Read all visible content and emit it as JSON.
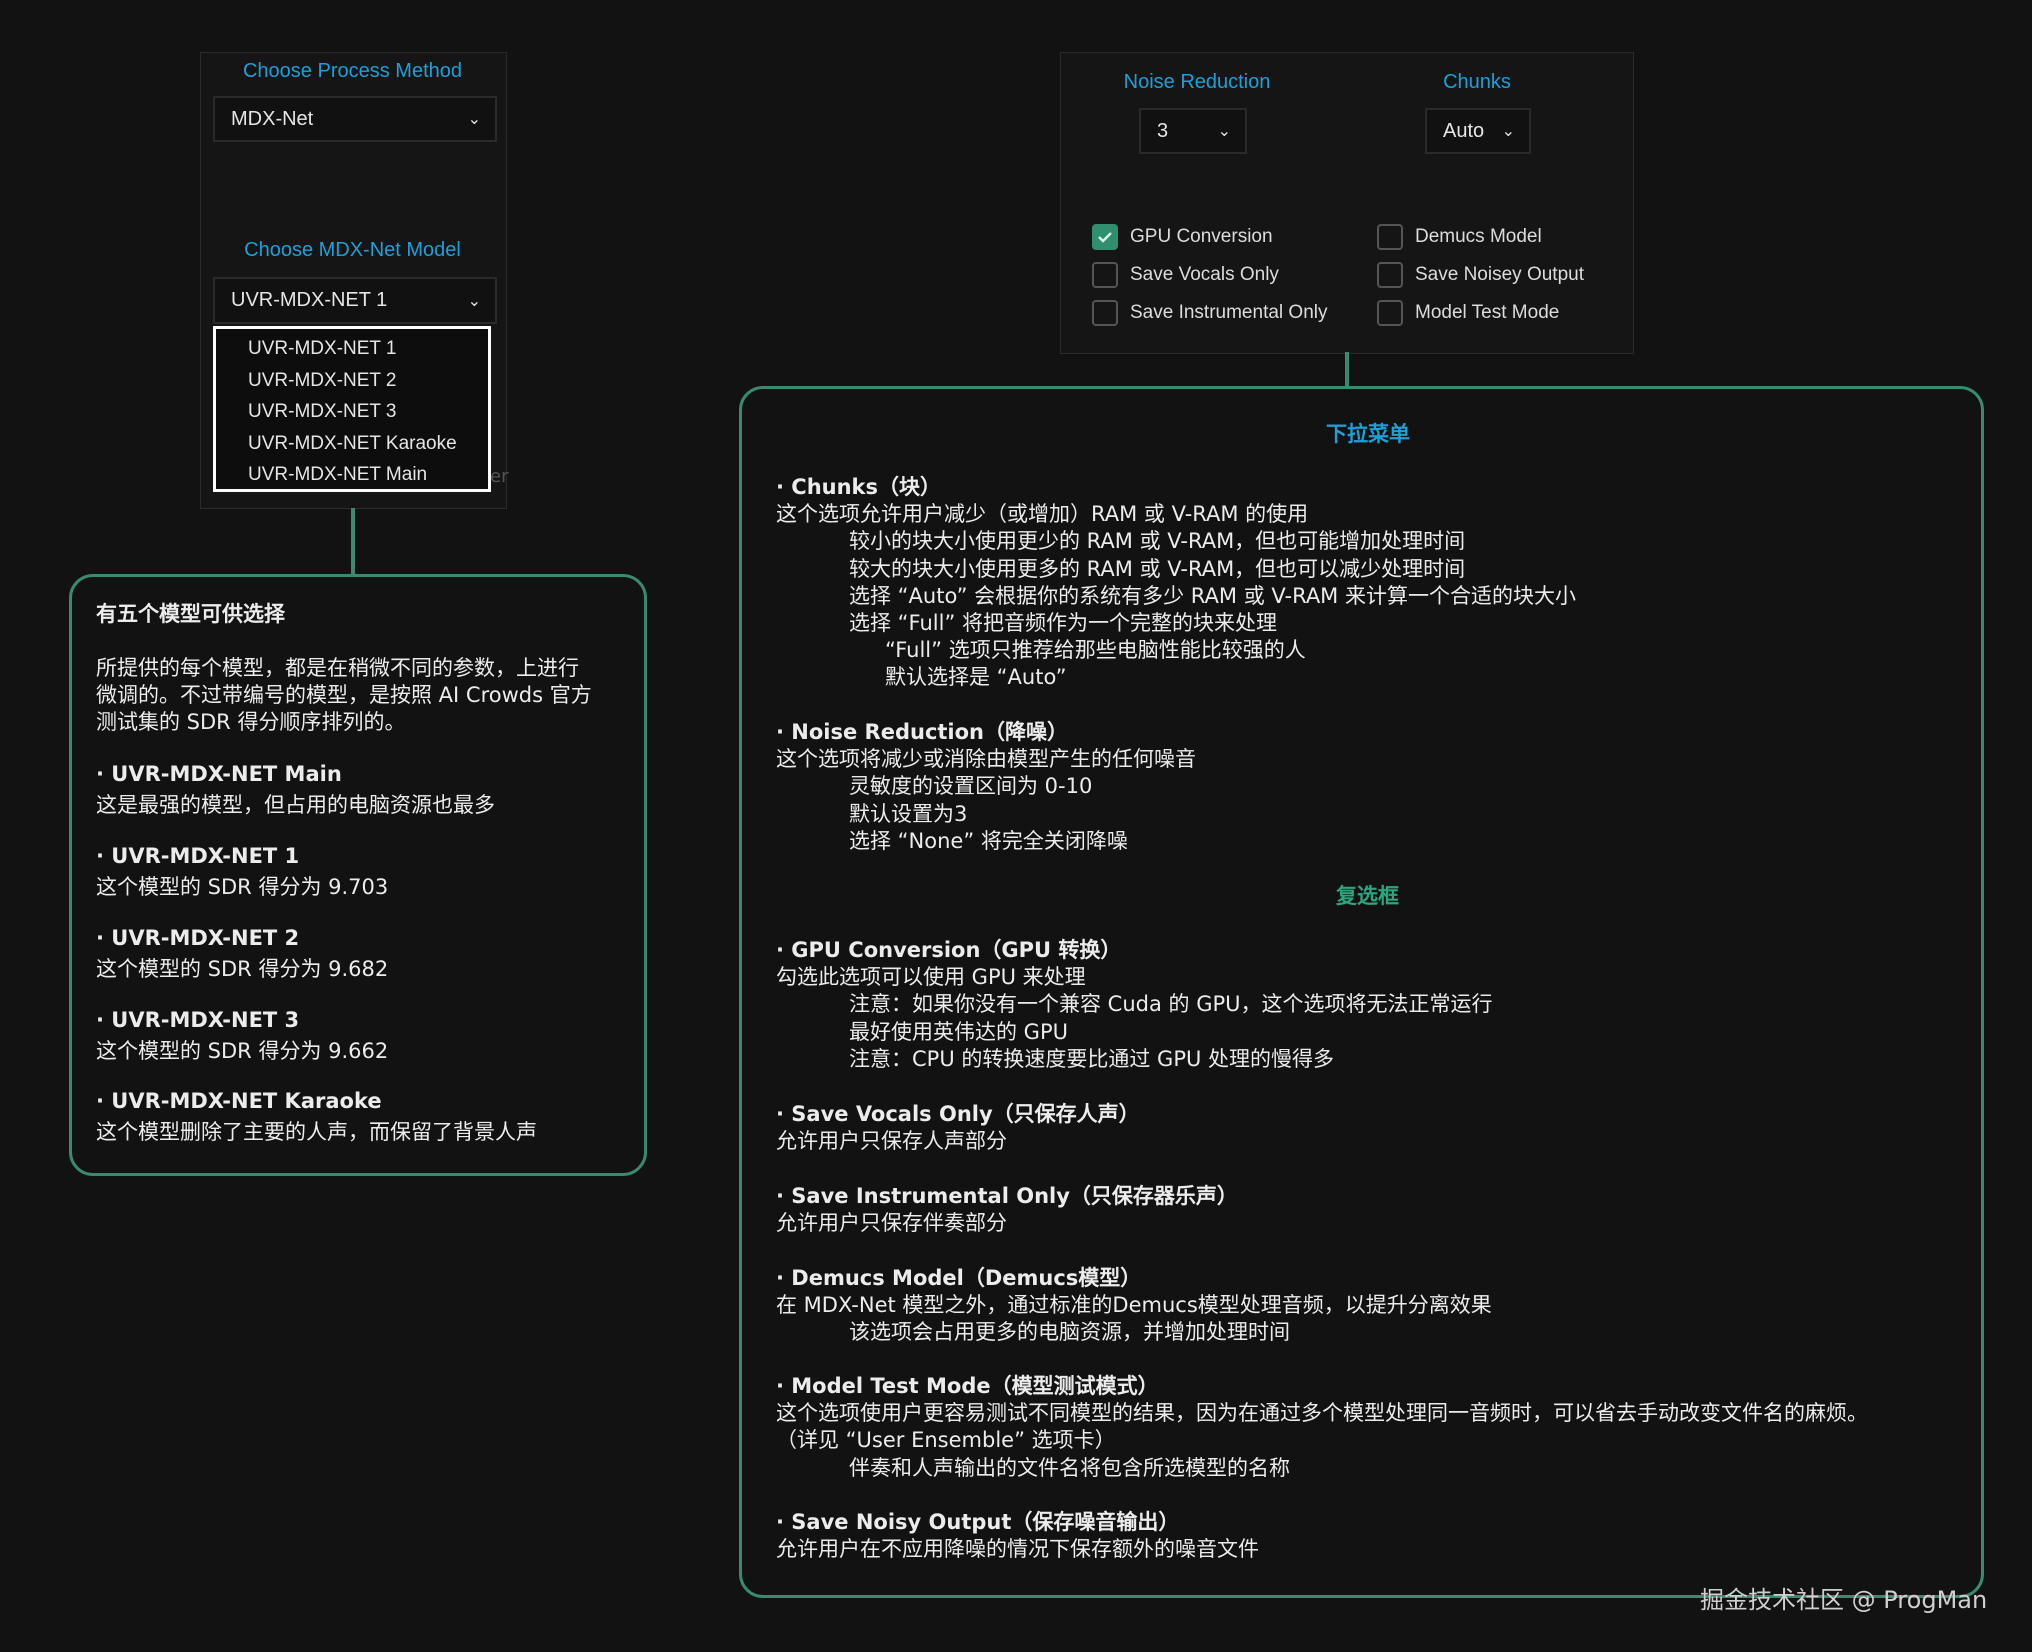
{
  "left_panel": {
    "process_method_label": "Choose Process Method",
    "process_method_value": "MDX-Net",
    "model_label": "Choose MDX-Net Model",
    "model_value": "UVR-MDX-NET 1",
    "model_options": [
      "UVR-MDX-NET 1",
      "UVR-MDX-NET 2",
      "UVR-MDX-NET 3",
      "UVR-MDX-NET Karaoke",
      "UVR-MDX-NET Main"
    ],
    "partial_char": "er"
  },
  "right_panel": {
    "noise_label": "Noise Reduction",
    "noise_value": "3",
    "chunks_label": "Chunks",
    "chunks_value": "Auto",
    "checkboxes": [
      {
        "label": "GPU Conversion",
        "checked": true
      },
      {
        "label": "Save Vocals Only",
        "checked": false
      },
      {
        "label": "Save Instrumental Only",
        "checked": false
      },
      {
        "label": "Demucs Model",
        "checked": false
      },
      {
        "label": "Save Noisey Output",
        "checked": false
      },
      {
        "label": "Model Test Mode",
        "checked": false
      }
    ]
  },
  "left_callout": {
    "title": "有五个模型可供选择",
    "intro": [
      "所提供的每个模型，都是在稍微不同的参数，上进行",
      "微调的。不过带编号的模型，是按照 AI Crowds 官方",
      "测试集的 SDR 得分顺序排列的。"
    ],
    "items": [
      {
        "name": "· UVR-MDX-NET Main",
        "desc": "这是最强的模型，但占用的电脑资源也最多"
      },
      {
        "name": "· UVR-MDX-NET 1",
        "desc": "这个模型的 SDR 得分为 9.703"
      },
      {
        "name": "· UVR-MDX-NET 2",
        "desc": "这个模型的 SDR 得分为 9.682"
      },
      {
        "name": "· UVR-MDX-NET 3",
        "desc": "这个模型的 SDR 得分为 9.662"
      },
      {
        "name": "· UVR-MDX-NET Karaoke",
        "desc": "这个模型删除了主要的人声，而保留了背景人声"
      }
    ]
  },
  "right_callout": {
    "dropdown_title": "下拉菜单",
    "checkbox_title": "复选框",
    "sections": [
      {
        "title": "· Chunks（块）",
        "lines": [
          {
            "t": "这个选项允许用户减少（或增加）RAM 或 V-RAM 的使用",
            "i": 0
          },
          {
            "t": "较小的块大小使用更少的 RAM 或 V-RAM，但也可能增加处理时间",
            "i": 1
          },
          {
            "t": "较大的块大小使用更多的 RAM 或 V-RAM，但也可以减少处理时间",
            "i": 1
          },
          {
            "t": "选择 “Auto” 会根据你的系统有多少 RAM 或 V-RAM 来计算一个合适的块大小",
            "i": 1
          },
          {
            "t": "选择 “Full” 将把音频作为一个完整的块来处理",
            "i": 1
          },
          {
            "t": "“Full” 选项只推荐给那些电脑性能比较强的人",
            "i": 2
          },
          {
            "t": "默认选择是 “Auto”",
            "i": 2
          }
        ]
      },
      {
        "title": "· Noise Reduction（降噪）",
        "lines": [
          {
            "t": "这个选项将减少或消除由模型产生的任何噪音",
            "i": 0
          },
          {
            "t": "灵敏度的设置区间为 0-10",
            "i": 1
          },
          {
            "t": "默认设置为3",
            "i": 1
          },
          {
            "t": "选择 “None” 将完全关闭降噪",
            "i": 1
          }
        ]
      },
      {
        "title": "· GPU Conversion（GPU 转换）",
        "lines": [
          {
            "t": "勾选此选项可以使用 GPU 来处理",
            "i": 0
          },
          {
            "t": "注意：如果你没有一个兼容 Cuda 的 GPU，这个选项将无法正常运行",
            "i": 1
          },
          {
            "t": "最好使用英伟达的 GPU",
            "i": 1
          },
          {
            "t": "注意：CPU 的转换速度要比通过 GPU 处理的慢得多",
            "i": 1
          }
        ]
      },
      {
        "title": "· Save Vocals Only（只保存人声）",
        "lines": [
          {
            "t": "允许用户只保存人声部分",
            "i": 0
          }
        ]
      },
      {
        "title": "· Save Instrumental Only（只保存器乐声）",
        "lines": [
          {
            "t": "允许用户只保存伴奏部分",
            "i": 0
          }
        ]
      },
      {
        "title": "· Demucs Model（Demucs模型）",
        "lines": [
          {
            "t": "在 MDX-Net 模型之外，通过标准的Demucs模型处理音频，以提升分离效果",
            "i": 0
          },
          {
            "t": "该选项会占用更多的电脑资源，并增加处理时间",
            "i": 1
          }
        ]
      },
      {
        "title": "· Model Test Mode（模型测试模式）",
        "lines": [
          {
            "t": "这个选项使用户更容易测试不同模型的结果，因为在通过多个模型处理同一音频时，可以省去手动改变文件名的麻烦。",
            "i": 0
          },
          {
            "t": "（详见 “User Ensemble” 选项卡）",
            "i": 0
          },
          {
            "t": "伴奏和人声输出的文件名将包含所选模型的名称",
            "i": 1
          }
        ]
      },
      {
        "title": "· Save Noisy Output（保存噪音输出）",
        "lines": [
          {
            "t": "允许用户在不应用降噪的情况下保存额外的噪音文件",
            "i": 0
          }
        ]
      }
    ]
  },
  "watermark": "掘金技术社区 @ ProgMan"
}
